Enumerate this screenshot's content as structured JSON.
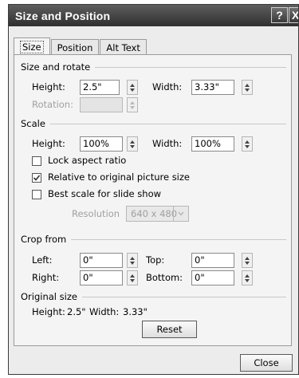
{
  "window": {
    "title": "Size and Position",
    "help_glyph": "?",
    "close_glyph": "X"
  },
  "tabs": [
    {
      "label": "Size",
      "active": true
    },
    {
      "label": "Position",
      "active": false
    },
    {
      "label": "Alt Text",
      "active": false
    }
  ],
  "size_rotate": {
    "group_label": "Size and rotate",
    "height_label": "Height:",
    "height_value": "2.5\"",
    "width_label": "Width:",
    "width_value": "3.33\"",
    "rotation_label": "Rotation:",
    "rotation_value": ""
  },
  "scale": {
    "group_label": "Scale",
    "height_label": "Height:",
    "height_value": "100%",
    "width_label": "Width:",
    "width_value": "100%",
    "lock_aspect_label": "Lock aspect ratio",
    "lock_aspect_checked": false,
    "relative_label": "Relative to original picture size",
    "relative_checked": true,
    "best_scale_label": "Best scale for slide show",
    "best_scale_checked": false,
    "resolution_label": "Resolution",
    "resolution_value": "640 x 480"
  },
  "crop": {
    "group_label": "Crop from",
    "left_label": "Left:",
    "left_value": "0\"",
    "top_label": "Top:",
    "top_value": "0\"",
    "right_label": "Right:",
    "right_value": "0\"",
    "bottom_label": "Bottom:",
    "bottom_value": "0\""
  },
  "original": {
    "group_label": "Original size",
    "height_label": "Height:",
    "height_value": "2.5\"",
    "width_label": "Width:",
    "width_value": "3.33\"",
    "reset_label": "Reset"
  },
  "footer": {
    "close_label": "Close"
  },
  "colors": {
    "titlebar": "#3f3f3f",
    "dialog_bg": "#ececec",
    "disabled_text": "#a0a0a0"
  }
}
